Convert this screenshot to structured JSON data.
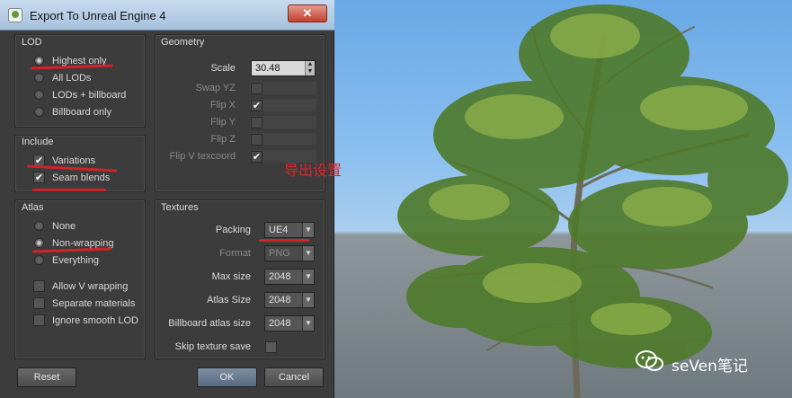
{
  "window": {
    "title": "Export To Unreal Engine 4",
    "close_glyph": "✕"
  },
  "lod": {
    "label": "LOD",
    "options": [
      "Highest only",
      "All LODs",
      "LODs + billboard",
      "Billboard only"
    ],
    "selected_index": 0
  },
  "include": {
    "label": "Include",
    "options": [
      {
        "label": "Variations",
        "checked": true
      },
      {
        "label": "Seam blends",
        "checked": true
      }
    ]
  },
  "atlas": {
    "label": "Atlas",
    "options": [
      "None",
      "Non-wrapping",
      "Everything"
    ],
    "selected_index": 1,
    "checks": [
      {
        "label": "Allow V wrapping",
        "checked": false
      },
      {
        "label": "Separate materials",
        "checked": false
      },
      {
        "label": "Ignore smooth LOD",
        "checked": false
      }
    ]
  },
  "geometry": {
    "label": "Geometry",
    "scale_label": "Scale",
    "scale_value": "30.48",
    "fields": [
      {
        "label": "Swap YZ",
        "checked": false
      },
      {
        "label": "Flip X",
        "checked": true
      },
      {
        "label": "Flip Y",
        "checked": false
      },
      {
        "label": "Flip Z",
        "checked": false
      },
      {
        "label": "Flip V texcoord",
        "checked": true
      }
    ]
  },
  "textures": {
    "label": "Textures",
    "packing": {
      "label": "Packing",
      "value": "UE4"
    },
    "format": {
      "label": "Format",
      "value": "PNG"
    },
    "max_size": {
      "label": "Max size",
      "value": "2048"
    },
    "atlas_size": {
      "label": "Atlas Size",
      "value": "2048"
    },
    "billboard_atlas_size": {
      "label": "Billboard atlas size",
      "value": "2048"
    },
    "skip_texture_save": {
      "label": "Skip texture save",
      "checked": false
    }
  },
  "buttons": {
    "reset": "Reset",
    "ok": "OK",
    "cancel": "Cancel"
  },
  "annotation": {
    "text": "导出设置",
    "color": "#e0242c"
  },
  "watermark": {
    "text": "seVen笔记"
  },
  "colors": {
    "dialog_bg": "#3c3c3c",
    "annotation_red": "#d2232a",
    "sky": "#8cc0ef"
  }
}
